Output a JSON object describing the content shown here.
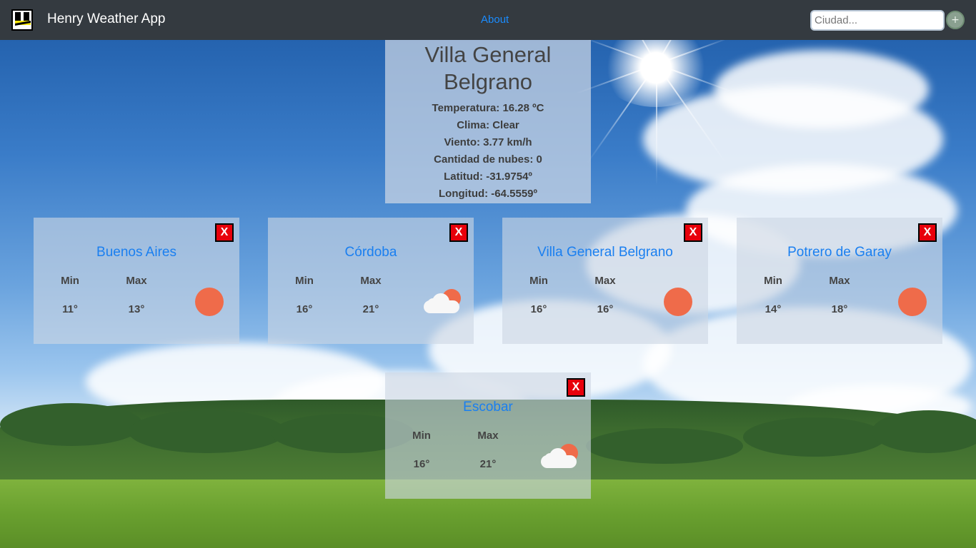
{
  "navbar": {
    "brand": "Henry Weather App",
    "about_link": "About",
    "search_placeholder": "Ciudad...",
    "add_button": "+"
  },
  "main_city": {
    "name": "Villa General Belgrano",
    "temperature": "Temperatura: 16.28 ºC",
    "weather": "Clima: Clear",
    "wind": "Viento: 3.77 km/h",
    "clouds": "Cantidad de nubes: 0",
    "latitude": "Latitud: -31.9754º",
    "longitude": "Longitud: -64.5559º"
  },
  "labels": {
    "min": "Min",
    "max": "Max",
    "close": "X"
  },
  "cards": [
    {
      "name": "Buenos Aires",
      "min": "11°",
      "max": "13°",
      "icon": "sun-icon"
    },
    {
      "name": "Córdoba",
      "min": "16°",
      "max": "21°",
      "icon": "partly-cloudy-icon"
    },
    {
      "name": "Villa General Belgrano",
      "min": "16°",
      "max": "16°",
      "icon": "sun-icon"
    },
    {
      "name": "Potrero de Garay",
      "min": "14°",
      "max": "18°",
      "icon": "sun-icon"
    },
    {
      "name": "Escobar",
      "min": "16°",
      "max": "21°",
      "icon": "partly-cloudy-icon"
    }
  ],
  "colors": {
    "navbar": "#343a40",
    "link": "#1a8cff",
    "city_name": "#1a7ff0",
    "close_button": "#e8000b",
    "sun": "#ef6b4a"
  }
}
